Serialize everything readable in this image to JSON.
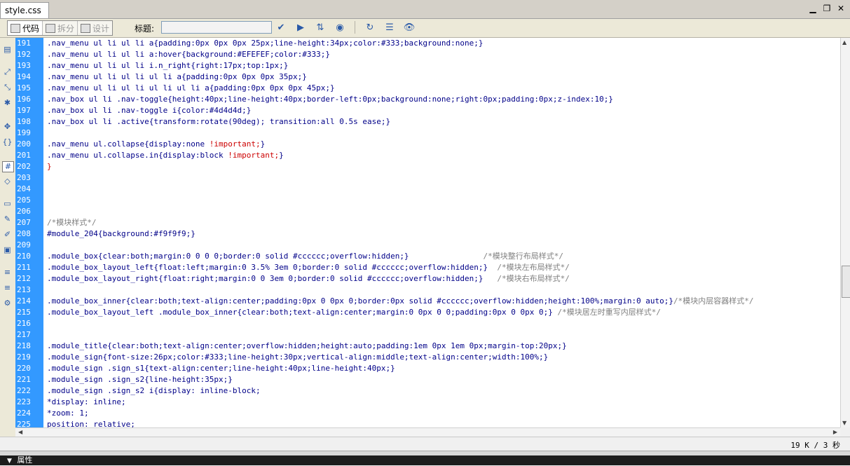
{
  "tab": {
    "title": "style.css"
  },
  "window_buttons": {
    "minimize": "▁",
    "restore": "❐",
    "close": "✕"
  },
  "toolbar": {
    "code_view": "代码",
    "split_view": "拆分",
    "design_view": "设计",
    "title_label": "标题:",
    "title_value": ""
  },
  "editor": {
    "lines": [
      {
        "n": "191",
        "text": ".nav_menu ul li ul li a{padding:0px 0px 0px 25px;line-height:34px;color:#333;background:none;}"
      },
      {
        "n": "192",
        "text": ".nav_menu ul li ul li a:hover{background:#EFEFEF;color:#333;}"
      },
      {
        "n": "193",
        "text": ".nav_menu ul li ul li i.n_right{right:17px;top:1px;}"
      },
      {
        "n": "194",
        "text": ".nav_menu ul li ul li ul li a{padding:0px 0px 0px 35px;}"
      },
      {
        "n": "195",
        "text": ".nav_menu ul li ul li ul li ul li a{padding:0px 0px 0px 45px;}"
      },
      {
        "n": "196",
        "text": ".nav_box ul li .nav-toggle{height:40px;line-height:40px;border-left:0px;background:none;right:0px;padding:0px;z-index:10;}"
      },
      {
        "n": "197",
        "text": ".nav_box ul li .nav-toggle i{color:#4d4d4d;}"
      },
      {
        "n": "198",
        "text": ".nav_box ul li .active{transform:rotate(90deg); transition:all 0.5s ease;}"
      },
      {
        "n": "199",
        "text": ""
      },
      {
        "n": "200",
        "text": ".nav_menu ul.collapse{display:none ",
        "imp": "!important;",
        "rest": "}"
      },
      {
        "n": "201",
        "text": ".nav_menu ul.collapse.in{display:block ",
        "imp": "!important;",
        "rest": "}"
      },
      {
        "n": "202",
        "text": "}",
        "red": true
      },
      {
        "n": "203",
        "text": ""
      },
      {
        "n": "204",
        "text": ""
      },
      {
        "n": "205",
        "text": ""
      },
      {
        "n": "206",
        "text": ""
      },
      {
        "n": "207",
        "text": "",
        "comment": "/*模块样式*/"
      },
      {
        "n": "208",
        "text": "#module_204{background:#f9f9f9;}"
      },
      {
        "n": "209",
        "text": ""
      },
      {
        "n": "210",
        "text": ".module_box{clear:both;margin:0 0 0 0;border:0 solid #cccccc;overflow:hidden;}                ",
        "comment": "/*模块整行布局样式*/"
      },
      {
        "n": "211",
        "text": ".module_box_layout_left{float:left;margin:0 3.5% 3em 0;border:0 solid #cccccc;overflow:hidden;}  ",
        "comment": "/*模块左布局样式*/"
      },
      {
        "n": "212",
        "text": ".module_box_layout_right{float:right;margin:0 0 3em 0;border:0 solid #cccccc;overflow:hidden;}   ",
        "comment": "/*模块右布局样式*/"
      },
      {
        "n": "213",
        "text": ""
      },
      {
        "n": "214",
        "text": ".module_box_inner{clear:both;text-align:center;padding:0px 0 0px 0;border:0px solid #cccccc;overflow:hidden;height:100%;margin:0 auto;}",
        "comment": "/*模块内层容器样式*/"
      },
      {
        "n": "215",
        "text": ".module_box_layout_left .module_box_inner{clear:both;text-align:center;margin:0 0px 0 0;padding:0px 0 0px 0;} ",
        "comment": "/*模块居左时重写内层样式*/"
      },
      {
        "n": "216",
        "text": ""
      },
      {
        "n": "217",
        "text": ""
      },
      {
        "n": "218",
        "text": ".module_title{clear:both;text-align:center;overflow:hidden;height:auto;padding:1em 0px 1em 0px;margin-top:20px;}"
      },
      {
        "n": "219",
        "text": ".module_sign{font-size:26px;color:#333;line-height:30px;vertical-align:middle;text-align:center;width:100%;}"
      },
      {
        "n": "220",
        "text": ".module_sign .sign_s1{text-align:center;line-height:40px;line-height:40px;}"
      },
      {
        "n": "221",
        "text": ".module_sign .sign_s2{line-height:35px;}"
      },
      {
        "n": "222",
        "text": ".module_sign .sign_s2 i{display: inline-block;"
      },
      {
        "n": "223",
        "text": "*display: inline;"
      },
      {
        "n": "224",
        "text": "*zoom: 1;"
      },
      {
        "n": "225",
        "text": "position: relative;"
      }
    ]
  },
  "status": {
    "size_time": "19 K / 3 秒"
  },
  "panel": {
    "properties_label": "属性"
  },
  "colors": {
    "gutter": "#3399ff",
    "code": "#000088",
    "comment": "#808080",
    "important": "#cc0000"
  }
}
